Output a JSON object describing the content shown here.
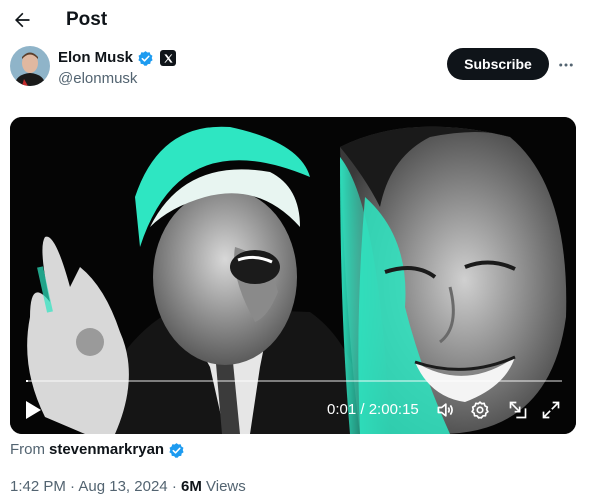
{
  "header": {
    "title": "Post",
    "back_icon": "arrow-left-icon"
  },
  "author": {
    "display_name": "Elon Musk",
    "handle": "@elonmusk",
    "verified_icon": "verified-badge-icon",
    "affiliation_icon": "x-logo-icon"
  },
  "actions": {
    "subscribe_label": "Subscribe",
    "more_icon": "more-horizontal-icon"
  },
  "video": {
    "current_time": "0:01",
    "separator": "/",
    "duration": "2:00:15",
    "progress": 0.0001,
    "controls": [
      "play-icon",
      "volume-icon",
      "settings-icon",
      "dock-icon",
      "fullscreen-icon"
    ]
  },
  "source": {
    "prefix": "From",
    "user": "stevenmarkryan"
  },
  "meta": {
    "time": "1:42 PM",
    "dot": "·",
    "date": "Aug 13, 2024",
    "views_count": "6M",
    "views_label": "Views"
  },
  "colors": {
    "accent": "#1d9bf0",
    "text": "#0f1419",
    "secondary": "#536471",
    "video_tint": "#2ee6c2"
  }
}
